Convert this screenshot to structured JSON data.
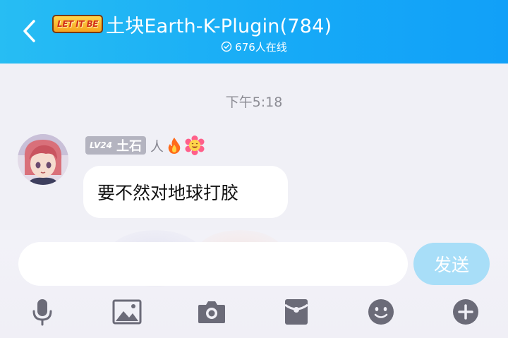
{
  "header": {
    "logo_text": "LET IT BE",
    "title": "土块Earth-K-Plugin(784)",
    "online": "676人在线",
    "back_icon": "chevron-left-icon"
  },
  "colors": {
    "header_start": "#27bdf3",
    "header_end": "#11a0f8",
    "send_button": "#a8def8",
    "badge": "#b4b4c0"
  },
  "chat": {
    "timestamp": "下午5:18",
    "messages": [
      {
        "level": "LV24",
        "sender": "土石",
        "role": "人",
        "text": "要不然对地球打胶"
      }
    ]
  },
  "composer": {
    "input_value": "",
    "send_label": "发送",
    "tools": [
      "microphone-icon",
      "image-icon",
      "camera-icon",
      "red-packet-icon",
      "emoji-icon",
      "plus-icon"
    ]
  }
}
